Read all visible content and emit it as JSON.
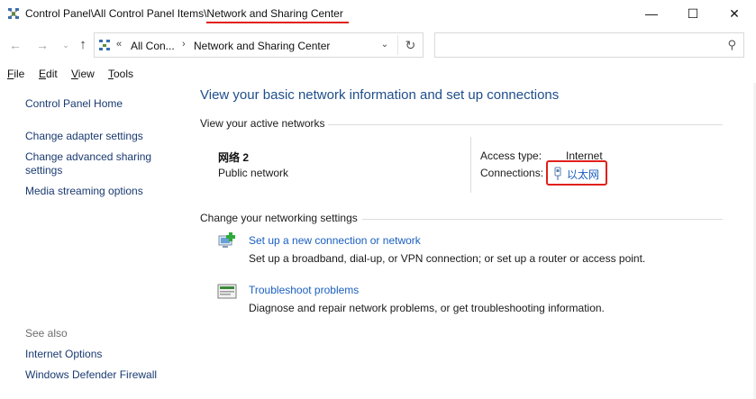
{
  "window": {
    "title": "Control Panel\\All Control Panel Items\\Network and Sharing Center",
    "minimize_glyph": "—",
    "maximize_glyph": "☐",
    "close_glyph": "✕"
  },
  "nav": {
    "back_glyph": "←",
    "forward_glyph": "→",
    "recent_glyph": "⌄",
    "up_glyph": "↑",
    "address": {
      "overflow_glyph": "«",
      "crumb1": "All Con...",
      "separator_glyph": "›",
      "crumb2": "Network and Sharing Center",
      "dropdown_glyph": "⌄",
      "refresh_glyph": "↻"
    },
    "search": {
      "placeholder": "",
      "icon_glyph": "⚲"
    }
  },
  "menu": {
    "items": [
      {
        "first": "F",
        "rest": "ile"
      },
      {
        "first": "E",
        "rest": "dit"
      },
      {
        "first": "V",
        "rest": "iew"
      },
      {
        "first": "T",
        "rest": "ools"
      }
    ]
  },
  "sidebar": {
    "home": "Control Panel Home",
    "links": [
      "Change adapter settings",
      "Change advanced sharing settings",
      "Media streaming options"
    ],
    "see_also_label": "See also",
    "see_also": [
      "Internet Options",
      "Windows Defender Firewall"
    ]
  },
  "main": {
    "title": "View your basic network information and set up connections",
    "active_networks_heading": "View your active networks",
    "network": {
      "name": "网络 2",
      "category": "Public network",
      "access_type_label": "Access type:",
      "access_type_value": "Internet",
      "connections_label": "Connections:",
      "connection_name": "以太网"
    },
    "change_settings_heading": "Change your networking settings",
    "tasks": [
      {
        "link": "Set up a new connection or network",
        "description": "Set up a broadband, dial-up, or VPN connection; or set up a router or access point."
      },
      {
        "link": "Troubleshoot problems",
        "description": "Diagnose and repair network problems, or get troubleshooting information."
      }
    ]
  },
  "colors": {
    "link": "#1a5fc0",
    "title_blue": "#1e4e8c",
    "highlight_red": "#e0201b"
  }
}
